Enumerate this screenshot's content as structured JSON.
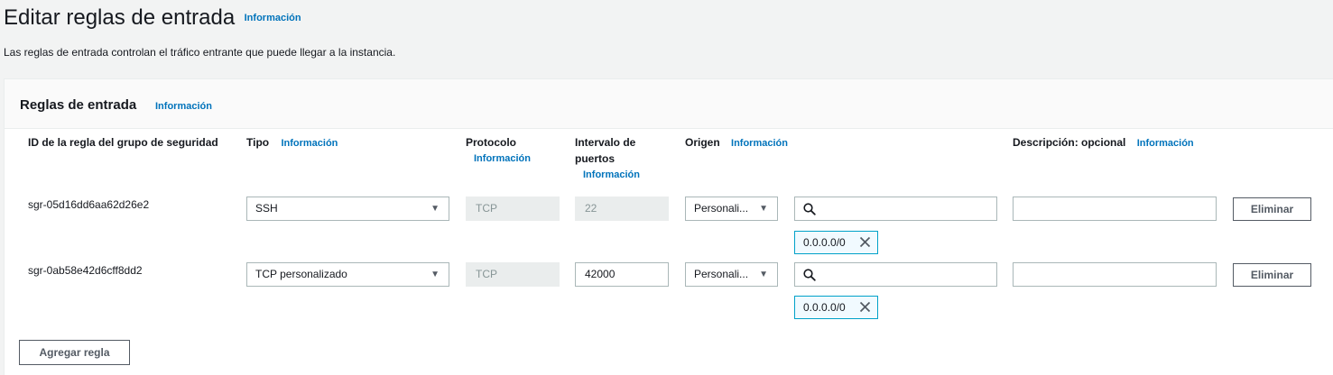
{
  "header": {
    "title": "Editar reglas de entrada",
    "info": "Información",
    "description": "Las reglas de entrada controlan el tráfico entrante que puede llegar a la instancia."
  },
  "panel": {
    "title": "Reglas de entrada",
    "info": "Información"
  },
  "columns": {
    "rule_id": "ID de la regla del grupo de seguridad",
    "type": "Tipo",
    "type_info": "Información",
    "protocol": "Protocolo",
    "protocol_info": "Información",
    "port_range_line1": "Intervalo de",
    "port_range_line2": "puertos",
    "port_range_info": "Información",
    "source": "Origen",
    "source_info": "Información",
    "description": "Descripción: opcional",
    "description_info": "Información"
  },
  "rules": [
    {
      "id": "sgr-05d16dd6aa62d26e2",
      "type": "SSH",
      "protocol": "TCP",
      "port_range": "22",
      "source_type": "Personali...",
      "source_search_value": "",
      "source_token": "0.0.0.0/0",
      "description": "",
      "delete_label": "Eliminar"
    },
    {
      "id": "sgr-0ab58e42d6cff8dd2",
      "type": "TCP personalizado",
      "protocol": "TCP",
      "port_range": "42000",
      "source_type": "Personali...",
      "source_search_value": "",
      "source_token": "0.0.0.0/0",
      "description": "",
      "delete_label": "Eliminar"
    }
  ],
  "add_rule_label": "Agregar regla",
  "icons": {
    "search": "search-icon",
    "caret": "caret-down-icon",
    "remove": "close-icon"
  },
  "colors": {
    "info_link": "#0073bb",
    "token_border": "#00a1c9",
    "token_bg": "#f1faff",
    "page_bg": "#f2f3f3"
  }
}
